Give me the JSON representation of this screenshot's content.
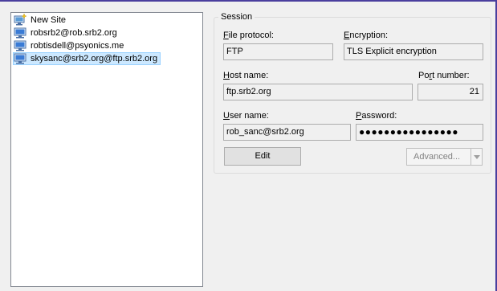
{
  "sites": [
    {
      "label": "New Site",
      "icon": "new-site-icon"
    },
    {
      "label": "robsrb2@rob.srb2.org",
      "icon": "computer-icon"
    },
    {
      "label": "robtisdell@psyonics.me",
      "icon": "computer-icon"
    },
    {
      "label": "skysanc@srb2.org@ftp.srb2.org",
      "icon": "computer-icon",
      "selected": true
    }
  ],
  "session": {
    "legend": "Session",
    "file_protocol": {
      "label_key": "F",
      "label_rest": "ile protocol:",
      "value": "FTP"
    },
    "encryption": {
      "label_key": "E",
      "label_rest": "ncryption:",
      "value": "TLS Explicit encryption"
    },
    "host_name": {
      "label_key": "H",
      "label_rest": "ost name:",
      "value": "ftp.srb2.org"
    },
    "port_number": {
      "label_pre": "Po",
      "label_key": "r",
      "label_rest": "t number:",
      "value": "21"
    },
    "user_name": {
      "label_key": "U",
      "label_rest": "ser name:",
      "value": "rob_sanc@srb2.org"
    },
    "password": {
      "label_key": "P",
      "label_rest": "assword:",
      "value": "●●●●●●●●●●●●●●●●"
    },
    "edit_button": "Edit",
    "advanced_button": "Advanced...",
    "colors": {
      "selection": "#cce8ff",
      "frame": "#4a3f9e"
    }
  }
}
